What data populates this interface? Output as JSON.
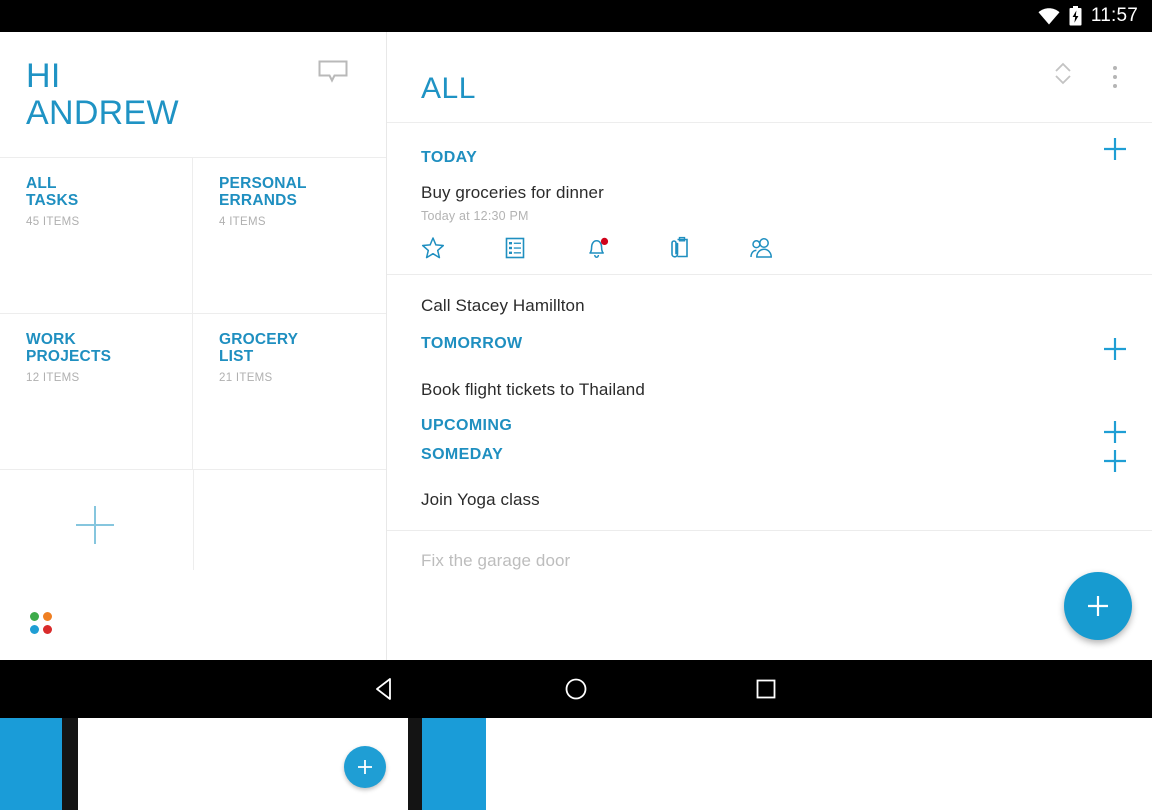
{
  "status_bar": {
    "time": "11:57",
    "icons": [
      "wifi-icon",
      "battery-charging-icon"
    ]
  },
  "colors": {
    "accent": "#1f93c4",
    "accent_dark": "#1f8fc0",
    "fab": "#179bd0",
    "muted": "#b0b0b0",
    "task_text": "#2b2b2b",
    "divider": "#ececec",
    "dot_green": "#3dab4a",
    "dot_orange": "#ef7f22",
    "dot_blue": "#1f9ed4",
    "dot_red": "#d92b2b",
    "badge_red": "#d0021b"
  },
  "sidebar": {
    "greeting_line1": "HI",
    "greeting_line2": "ANDREW",
    "chat_icon": "chat-bubble-icon",
    "add_collection_label": "+",
    "collections": [
      {
        "title_line1": "ALL",
        "title_line2": "TASKS",
        "count": "45 ITEMS"
      },
      {
        "title_line1": "PERSONAL",
        "title_line2": "ERRANDS",
        "count": "4 ITEMS"
      },
      {
        "title_line1": "WORK",
        "title_line2": "PROJECTS",
        "count": "12 ITEMS"
      },
      {
        "title_line1": "GROCERY",
        "title_line2": "LIST",
        "count": "21 ITEMS"
      }
    ],
    "logo_dots": [
      "green",
      "orange",
      "blue",
      "red"
    ]
  },
  "main": {
    "title": "ALL",
    "header_icons": [
      "sort-chevrons-icon",
      "overflow-menu-icon"
    ],
    "add_label": "+",
    "sections": [
      {
        "label": "TODAY",
        "tasks": [
          {
            "title": "Buy groceries for dinner",
            "subtitle": "Today at 12:30 PM",
            "faded": false,
            "actions": [
              "star-icon",
              "checklist-icon",
              "reminder-bell-icon",
              "attachment-clipboard-icon",
              "share-people-icon"
            ]
          },
          {
            "title": "Call Stacey Hamillton",
            "subtitle": "",
            "faded": false,
            "actions": []
          }
        ]
      },
      {
        "label": "TOMORROW",
        "tasks": [
          {
            "title": "Book flight tickets to Thailand",
            "subtitle": "",
            "faded": false,
            "actions": []
          }
        ]
      },
      {
        "label": "UPCOMING",
        "tasks": []
      },
      {
        "label": "SOMEDAY",
        "tasks": [
          {
            "title": "Join Yoga class",
            "subtitle": "",
            "faded": false,
            "actions": []
          },
          {
            "title": "Fix the garage door",
            "subtitle": "",
            "faded": true,
            "actions": []
          }
        ]
      }
    ],
    "fab_label": "+"
  },
  "nav_bar": {
    "buttons": [
      "back-triangle-icon",
      "home-circle-icon",
      "recents-square-icon"
    ]
  },
  "bottom_strip": {
    "fab_label": "+"
  }
}
